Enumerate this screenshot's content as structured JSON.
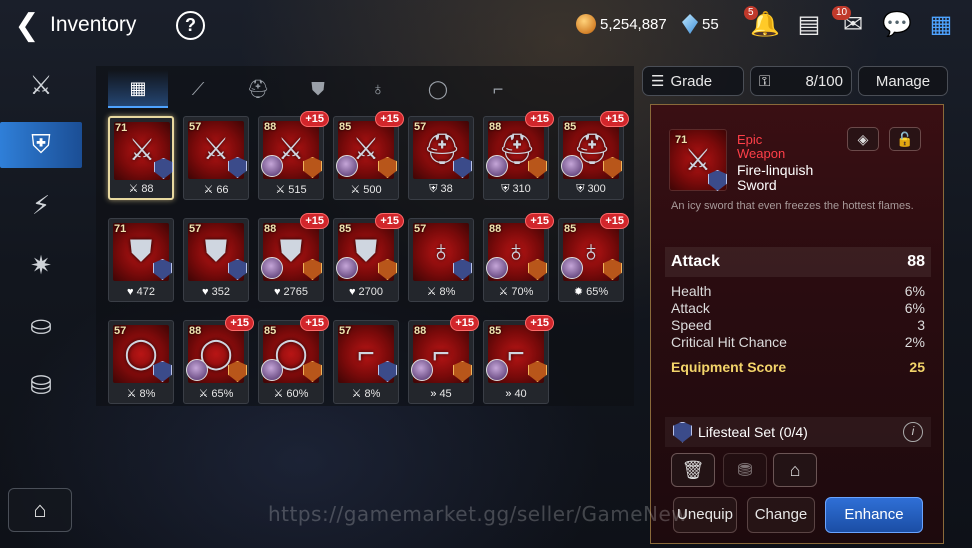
{
  "header": {
    "title": "Inventory",
    "gold": "5,254,887",
    "crystals": "55",
    "bell_badge": "5",
    "mail_badge": "10"
  },
  "tabs": [
    {
      "name": "all",
      "icon": "grid-icon",
      "glyph": "▦"
    },
    {
      "name": "weapon",
      "icon": "sword-icon",
      "glyph": "⟋"
    },
    {
      "name": "helmet",
      "icon": "helmet-icon",
      "glyph": "⛑"
    },
    {
      "name": "armor",
      "icon": "armor-icon",
      "glyph": "⛊"
    },
    {
      "name": "necklace",
      "icon": "necklace-icon",
      "glyph": "♁"
    },
    {
      "name": "ring",
      "icon": "ring-icon",
      "glyph": "◯"
    },
    {
      "name": "boots",
      "icon": "boots-icon",
      "glyph": "⌐"
    }
  ],
  "filter": {
    "sort_label": "Grade",
    "capacity": "8/100",
    "manage_label": "Manage"
  },
  "items": [
    {
      "level": "71",
      "plus": "",
      "stat_icon": "⚔",
      "stat": "88",
      "glyph": "⚔",
      "set": "blue",
      "hero": false,
      "selected": true
    },
    {
      "level": "57",
      "plus": "",
      "stat_icon": "⚔",
      "stat": "66",
      "glyph": "⚔",
      "set": "blue",
      "hero": false
    },
    {
      "level": "88",
      "plus": "+15",
      "stat_icon": "⚔",
      "stat": "515",
      "glyph": "⚔",
      "set": "orange",
      "hero": true
    },
    {
      "level": "85",
      "plus": "+15",
      "stat_icon": "⚔",
      "stat": "500",
      "glyph": "⚔",
      "set": "orange",
      "hero": true
    },
    {
      "level": "57",
      "plus": "",
      "stat_icon": "⛨",
      "stat": "38",
      "glyph": "⛑",
      "set": "blue",
      "hero": false
    },
    {
      "level": "88",
      "plus": "+15",
      "stat_icon": "⛨",
      "stat": "310",
      "glyph": "⛑",
      "set": "orange",
      "hero": true
    },
    {
      "level": "85",
      "plus": "+15",
      "stat_icon": "⛨",
      "stat": "300",
      "glyph": "⛑",
      "set": "orange",
      "hero": true
    },
    {
      "level": "71",
      "plus": "",
      "stat_icon": "♥",
      "stat": "472",
      "glyph": "⛊",
      "set": "blue",
      "hero": false
    },
    {
      "level": "57",
      "plus": "",
      "stat_icon": "♥",
      "stat": "352",
      "glyph": "⛊",
      "set": "blue",
      "hero": false
    },
    {
      "level": "88",
      "plus": "+15",
      "stat_icon": "♥",
      "stat": "2765",
      "glyph": "⛊",
      "set": "orange",
      "hero": true
    },
    {
      "level": "85",
      "plus": "+15",
      "stat_icon": "♥",
      "stat": "2700",
      "glyph": "⛊",
      "set": "orange",
      "hero": true
    },
    {
      "level": "57",
      "plus": "",
      "stat_icon": "⚔",
      "stat": "8%",
      "glyph": "♁",
      "set": "blue",
      "hero": false
    },
    {
      "level": "88",
      "plus": "+15",
      "stat_icon": "⚔",
      "stat": "70%",
      "glyph": "♁",
      "set": "orange",
      "hero": true
    },
    {
      "level": "85",
      "plus": "+15",
      "stat_icon": "✹",
      "stat": "65%",
      "glyph": "♁",
      "set": "orange",
      "hero": true
    },
    {
      "level": "57",
      "plus": "",
      "stat_icon": "⚔",
      "stat": "8%",
      "glyph": "◯",
      "set": "blue",
      "hero": false
    },
    {
      "level": "88",
      "plus": "+15",
      "stat_icon": "⚔",
      "stat": "65%",
      "glyph": "◯",
      "set": "orange",
      "hero": true
    },
    {
      "level": "85",
      "plus": "+15",
      "stat_icon": "⚔",
      "stat": "60%",
      "glyph": "◯",
      "set": "orange",
      "hero": true
    },
    {
      "level": "57",
      "plus": "",
      "stat_icon": "⚔",
      "stat": "8%",
      "glyph": "⌐",
      "set": "blue",
      "hero": false
    },
    {
      "level": "88",
      "plus": "+15",
      "stat_icon": "»",
      "stat": "45",
      "glyph": "⌐",
      "set": "orange",
      "hero": true
    },
    {
      "level": "85",
      "plus": "+15",
      "stat_icon": "»",
      "stat": "40",
      "glyph": "⌐",
      "set": "orange",
      "hero": true
    }
  ],
  "detail": {
    "level": "71",
    "rarity_line1": "Epic",
    "rarity_line2": "Weapon",
    "name_line1": "Fire-linquish",
    "name_line2": "Sword",
    "description": "An icy sword that even freezes the hottest flames.",
    "main_stat_label": "Attack",
    "main_stat_value": "88",
    "substats": [
      {
        "label": "Health",
        "value": "6%"
      },
      {
        "label": "Attack",
        "value": "6%"
      },
      {
        "label": "Speed",
        "value": "3"
      },
      {
        "label": "Critical Hit Chance",
        "value": "2%"
      }
    ],
    "score_label": "Equipment Score",
    "score_value": "25",
    "set_label": "Lifesteal Set",
    "set_progress": "(0/4)",
    "unequip_label": "Unequip",
    "change_label": "Change",
    "enhance_label": "Enhance"
  },
  "watermark": "https://gamemarket.gg/seller/GameNew",
  "colors": {
    "accent_blue": "#2f7fd8",
    "epic_red": "#ff3f48",
    "score_gold": "#f3d46a",
    "plus_badge": "#d1262b"
  }
}
